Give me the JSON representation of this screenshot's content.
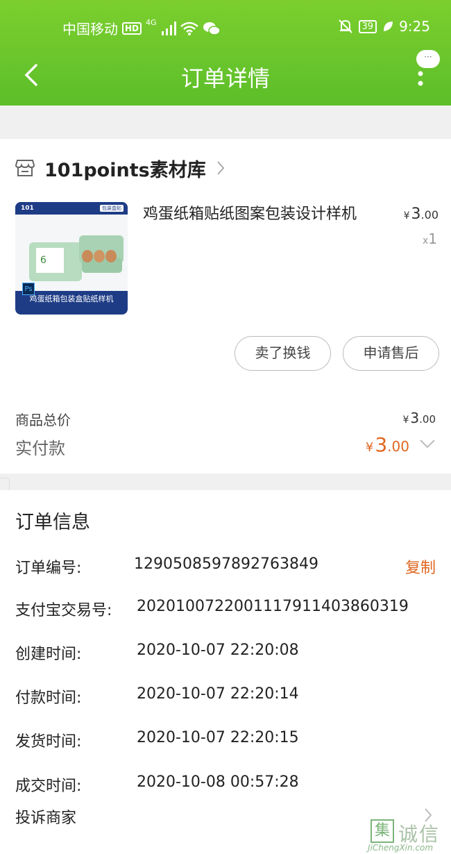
{
  "status_bar": {
    "carrier": "中国移动",
    "hd": "HD",
    "network": "4G",
    "battery": "39",
    "time": "9:25"
  },
  "nav": {
    "title": "订单详情",
    "bubble_text": "···"
  },
  "shop": {
    "name": "101points素材库"
  },
  "product": {
    "title": "鸡蛋纸箱贴纸图案包装设计样机",
    "price_symbol": "¥",
    "price_int": "3",
    "price_dec": ".00",
    "qty_prefix": "x",
    "qty": "1",
    "image": {
      "brand": "101",
      "tag": "包装盒贴",
      "ps": "Ps",
      "caption": "鸡蛋纸箱包装盒贴纸样机"
    }
  },
  "actions": {
    "sell_label": "卖了换钱",
    "after_sale_label": "申请售后"
  },
  "summary": {
    "total_label": "商品总价",
    "total_symbol": "¥",
    "total_int": "3",
    "total_dec": ".00",
    "paid_label": "实付款",
    "paid_symbol": "¥",
    "paid_int": "3",
    "paid_dec": ".00"
  },
  "order_info": {
    "title": "订单信息",
    "copy_label": "复制",
    "rows": [
      {
        "label": "订单编号:",
        "value": "1290508597892763849"
      },
      {
        "label": "支付宝交易号:",
        "value": "2020100722001117911403860319"
      },
      {
        "label": "创建时间:",
        "value": "2020-10-07 22:20:08"
      },
      {
        "label": "付款时间:",
        "value": "2020-10-07 22:20:14"
      },
      {
        "label": "发货时间:",
        "value": "2020-10-07 22:20:15"
      },
      {
        "label": "成交时间:",
        "value": "2020-10-08 00:57:28"
      }
    ],
    "complain_label": "投诉商家"
  },
  "watermark": {
    "box": "集",
    "text": "诚信",
    "url": "JiChengXin.com"
  },
  "colors": {
    "header_green": "#6cc62c",
    "accent_orange": "#e0661f"
  }
}
